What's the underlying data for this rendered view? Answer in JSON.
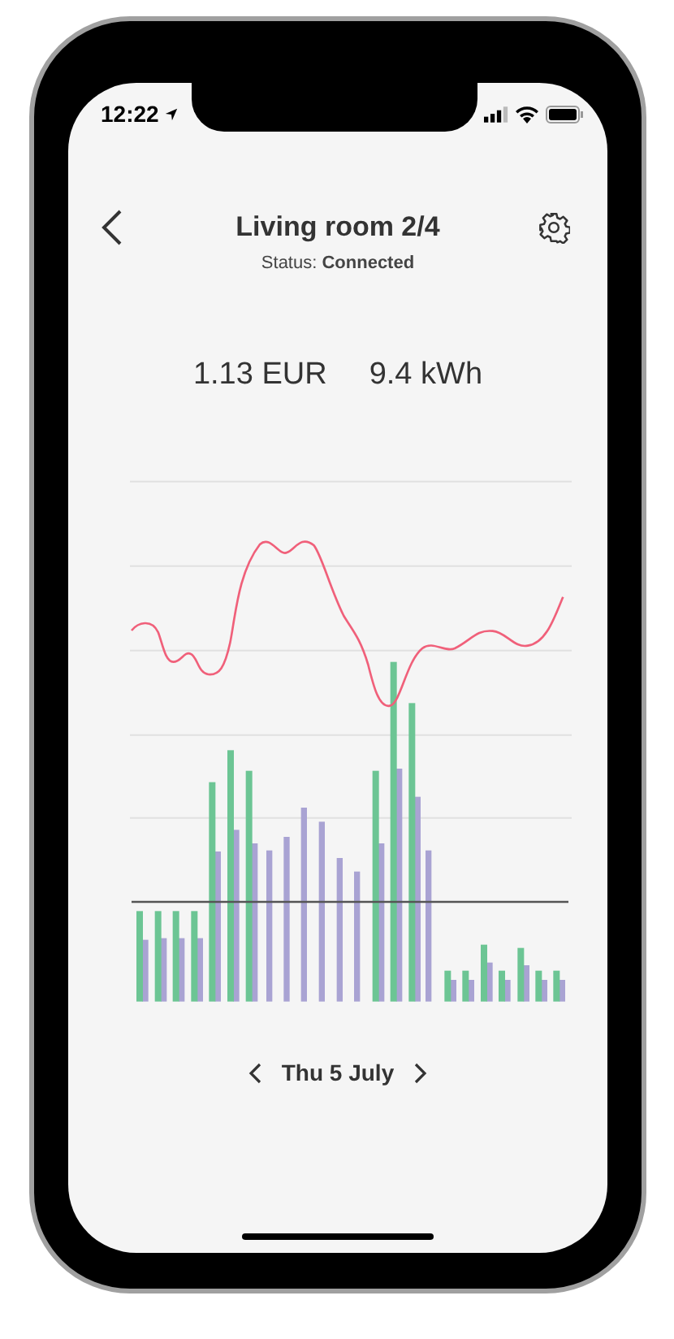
{
  "status_bar": {
    "time": "12:22"
  },
  "header": {
    "title": "Living room 2/4",
    "status": "Status: **Connected**"
  },
  "readings": [
    "1.13 EUR",
    "9.4 kWh"
  ],
  "date_nav": {
    "label": "Thu 5 July"
  }
}
